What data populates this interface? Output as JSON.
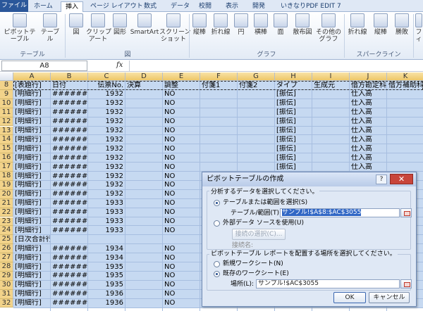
{
  "tabs": {
    "file": "ファイル",
    "home": "ホーム",
    "insert": "挿入",
    "page_layout": "ページ レイアウト",
    "formulas": "数式",
    "data": "データ",
    "review": "校閲",
    "view": "表示",
    "developer": "開発",
    "addin": "いきなりPDF EDIT 7"
  },
  "ribbon": {
    "pivot": "ピボットテーブル",
    "table": "テーブル",
    "picture": "図",
    "clipart": "クリップ\nアート",
    "shapes": "図形",
    "smartart": "SmartArt",
    "screenshot": "スクリーン\nショット",
    "col": "縦棒",
    "line": "折れ線",
    "pie": "円",
    "bar": "横棒",
    "area": "面",
    "scatter": "散布図",
    "other": "その他の\nグラフ",
    "sp_line": "折れ線",
    "sp_col": "縦棒",
    "sp_win": "勝敗",
    "fil": "フィ",
    "g_table": "テーブル",
    "g_fig": "図",
    "g_chart": "グラフ",
    "g_spark": "スパークライン"
  },
  "namebox": "A8",
  "fx": "fx",
  "columns": [
    "A",
    "B",
    "C",
    "D",
    "E",
    "F",
    "G",
    "H",
    "I",
    "J",
    "K"
  ],
  "header_row": {
    "num": "8",
    "a": "[表題行]",
    "b": "日付",
    "c": "伝票No.",
    "d": "決算",
    "e": "調整",
    "f": "付箋1",
    "g": "付箋2",
    "h": "タイプ",
    "i": "生成元",
    "j": "借方勘定科",
    "k": "借方補助科"
  },
  "rows": [
    {
      "num": "9",
      "a": "[明細行]",
      "b": "########",
      "c": "1932",
      "e": "NO",
      "h": "[振伝]",
      "j": "仕入高"
    },
    {
      "num": "10",
      "a": "[明細行]",
      "b": "########",
      "c": "1932",
      "e": "NO",
      "h": "[振伝]",
      "j": "仕入高"
    },
    {
      "num": "11",
      "a": "[明細行]",
      "b": "########",
      "c": "1932",
      "e": "NO",
      "h": "[振伝]",
      "j": "仕入高"
    },
    {
      "num": "12",
      "a": "[明細行]",
      "b": "########",
      "c": "1932",
      "e": "NO",
      "h": "[振伝]",
      "j": "仕入高"
    },
    {
      "num": "13",
      "a": "[明細行]",
      "b": "########",
      "c": "1932",
      "e": "NO",
      "h": "[振伝]",
      "j": "仕入高"
    },
    {
      "num": "14",
      "a": "[明細行]",
      "b": "########",
      "c": "1932",
      "e": "NO",
      "h": "[振伝]",
      "j": "仕入高"
    },
    {
      "num": "15",
      "a": "[明細行]",
      "b": "########",
      "c": "1932",
      "e": "NO",
      "h": "[振伝]",
      "j": "仕入高"
    },
    {
      "num": "16",
      "a": "[明細行]",
      "b": "########",
      "c": "1932",
      "e": "NO",
      "h": "[振伝]",
      "j": "仕入高"
    },
    {
      "num": "17",
      "a": "[明細行]",
      "b": "########",
      "c": "1932",
      "e": "NO",
      "h": "[振伝]",
      "j": "仕入高"
    },
    {
      "num": "18",
      "a": "[明細行]",
      "b": "########",
      "c": "1932",
      "e": "NO",
      "h": "[振伝]",
      "j": "仕入高"
    },
    {
      "num": "19",
      "a": "[明細行]",
      "b": "########",
      "c": "1932",
      "e": "NO",
      "h": "[振伝]",
      "j": "仕入高"
    },
    {
      "num": "20",
      "a": "[明細行]",
      "b": "########",
      "c": "1932",
      "e": "NO",
      "h": "[振伝]",
      "j": "仕入高"
    },
    {
      "num": "21",
      "a": "[明細行]",
      "b": "########",
      "c": "1933",
      "e": "NO",
      "h": "[振伝]",
      "j": "仕入高"
    },
    {
      "num": "22",
      "a": "[明細行]",
      "b": "########",
      "c": "1933",
      "e": "NO",
      "h": "[振伝]",
      "j": "仕入高"
    },
    {
      "num": "23",
      "a": "[明細行]",
      "b": "########",
      "c": "1933",
      "e": "NO",
      "h": "[振伝]",
      "j": "仕入高"
    },
    {
      "num": "24",
      "a": "[明細行]",
      "b": "########",
      "c": "1933",
      "e": "NO",
      "h": "[振伝]",
      "j": "仕入高"
    },
    {
      "num": "25",
      "a": "[日次合計行]",
      "b": "",
      "c": "",
      "e": "",
      "h": "",
      "j": ""
    },
    {
      "num": "26",
      "a": "[明細行]",
      "b": "########",
      "c": "1934",
      "e": "NO",
      "h": "[振伝]",
      "j": "仕入高"
    },
    {
      "num": "27",
      "a": "[明細行]",
      "b": "########",
      "c": "1934",
      "e": "NO",
      "h": "[振伝]",
      "j": "仕入高"
    },
    {
      "num": "28",
      "a": "[明細行]",
      "b": "########",
      "c": "1935",
      "e": "NO",
      "h": "[振伝]",
      "j": "仕入高"
    },
    {
      "num": "29",
      "a": "[明細行]",
      "b": "########",
      "c": "1935",
      "e": "NO",
      "h": "[振伝]",
      "j": "仕入高"
    },
    {
      "num": "30",
      "a": "[明細行]",
      "b": "########",
      "c": "1935",
      "e": "NO",
      "h": "[振伝]",
      "j": "仕入高"
    },
    {
      "num": "31",
      "a": "[明細行]",
      "b": "########",
      "c": "1936",
      "e": "NO",
      "h": "[振伝]",
      "j": "仕入高"
    },
    {
      "num": "32",
      "a": "[明細行]",
      "b": "########",
      "c": "1936",
      "e": "NO",
      "h": "[振伝]",
      "j": "仕入高"
    }
  ],
  "dialog": {
    "title": "ピボットテーブルの作成",
    "help": "?",
    "close": "✕",
    "sec1": "分析するデータを選択してください。",
    "opt_table": "テーブルまたは範囲を選択(S)",
    "range_label": "テーブル/範囲(T):",
    "range_value": "サンプル!$A$8:$AC$3055",
    "opt_external": "外部データ ソースを使用(U)",
    "conn_btn": "接続の選択(C)...",
    "conn_name": "接続名:",
    "sec2": "ピボットテーブル レポートを配置する場所を選択してください。",
    "opt_new": "新規ワークシート(N)",
    "opt_existing": "既存のワークシート(E)",
    "loc_label": "場所(L):",
    "loc_value": "サンプル!$AC$3055",
    "ok": "OK",
    "cancel": "キャンセル"
  }
}
